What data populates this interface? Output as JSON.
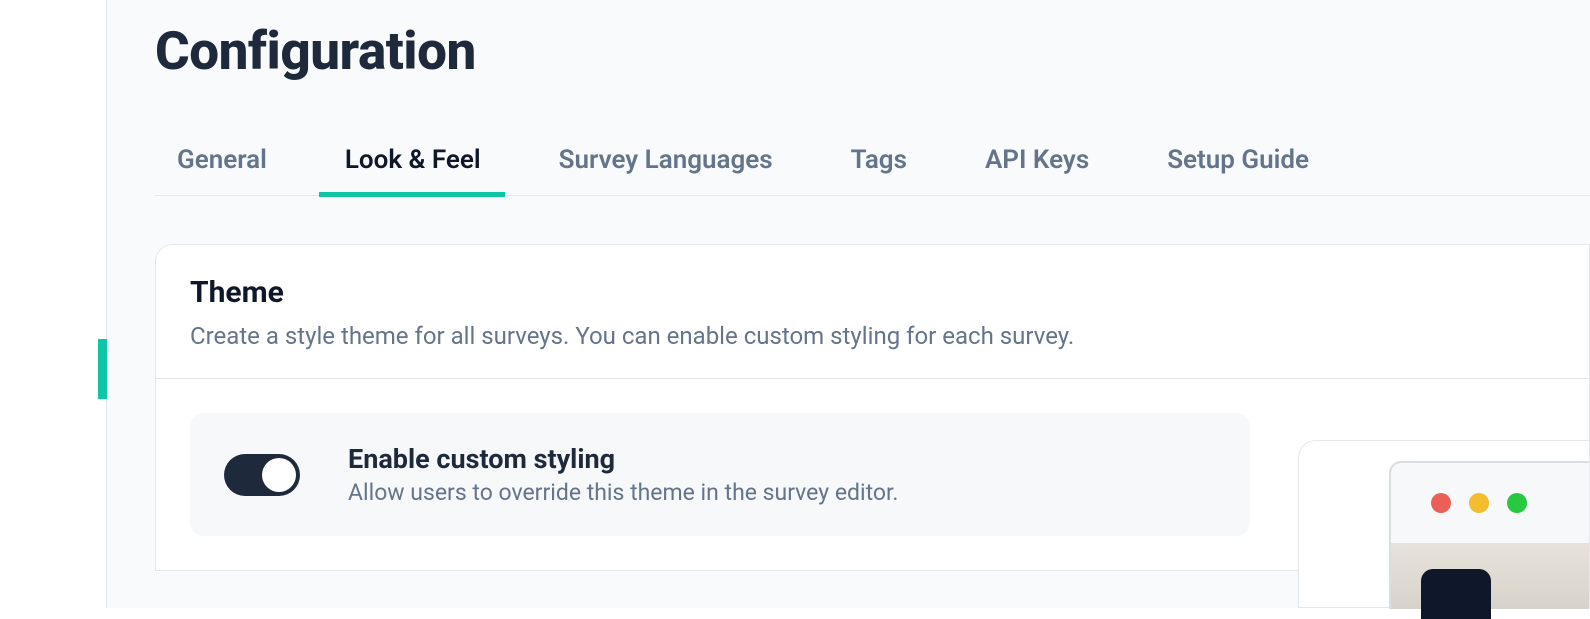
{
  "page": {
    "title": "Configuration"
  },
  "tabs": [
    {
      "label": "General",
      "active": false
    },
    {
      "label": "Look & Feel",
      "active": true
    },
    {
      "label": "Survey Languages",
      "active": false
    },
    {
      "label": "Tags",
      "active": false
    },
    {
      "label": "API Keys",
      "active": false
    },
    {
      "label": "Setup Guide",
      "active": false
    }
  ],
  "theme_card": {
    "title": "Theme",
    "description": "Create a style theme for all surveys. You can enable custom styling for each survey."
  },
  "custom_styling": {
    "title": "Enable custom styling",
    "description": "Allow users to override this theme in the survey editor.",
    "enabled": true
  },
  "colors": {
    "accent": "#0ec6a6",
    "text_primary": "#1e293b",
    "text_secondary": "#64748b"
  }
}
